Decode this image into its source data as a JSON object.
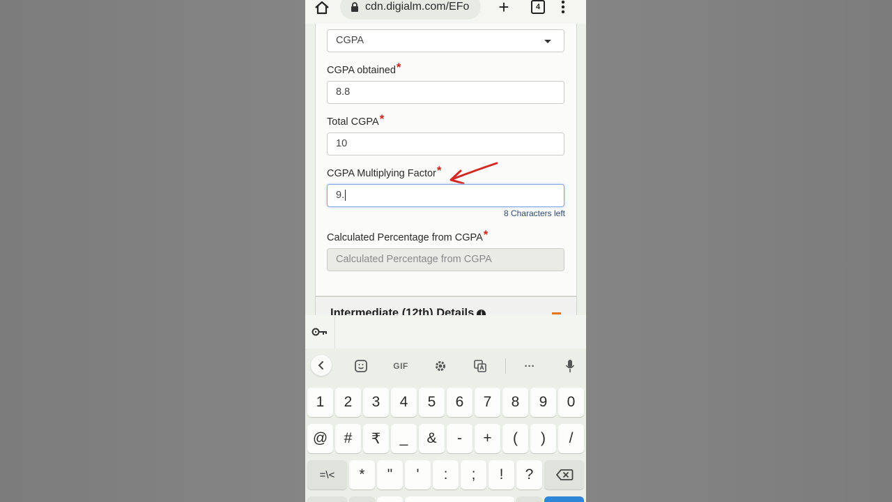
{
  "browser": {
    "url": "cdn.digialm.com/EFo",
    "tab_count": "4"
  },
  "form": {
    "select_value": "CGPA",
    "fields": [
      {
        "label": "CGPA obtained",
        "value": "8.8"
      },
      {
        "label": "Total CGPA",
        "value": "10"
      },
      {
        "label": "CGPA Multiplying Factor",
        "value": "9."
      },
      {
        "label": "Calculated Percentage from CGPA",
        "placeholder": "Calculated Percentage from CGPA"
      }
    ],
    "required_mark": "*",
    "chars_left": "8 Characters left",
    "next_section_title": "Intermediate (12th) Details",
    "info_glyph": "i"
  },
  "keyboard": {
    "toolbar": {
      "gif_label": "GIF",
      "more_label": "···"
    },
    "row1": [
      "1",
      "2",
      "3",
      "4",
      "5",
      "6",
      "7",
      "8",
      "9",
      "0"
    ],
    "row2": [
      "@",
      "#",
      "₹",
      "_",
      "&",
      "-",
      "+",
      "(",
      ")",
      "/"
    ],
    "row3": [
      "=\\<",
      "*",
      "\"",
      "'",
      ":",
      ";",
      "!",
      "?"
    ]
  },
  "colors": {
    "required": "#c8281e",
    "focus_border": "#7fa9e0",
    "annotation_arrow": "#d12a22",
    "collapse_accent": "#e2741d"
  }
}
